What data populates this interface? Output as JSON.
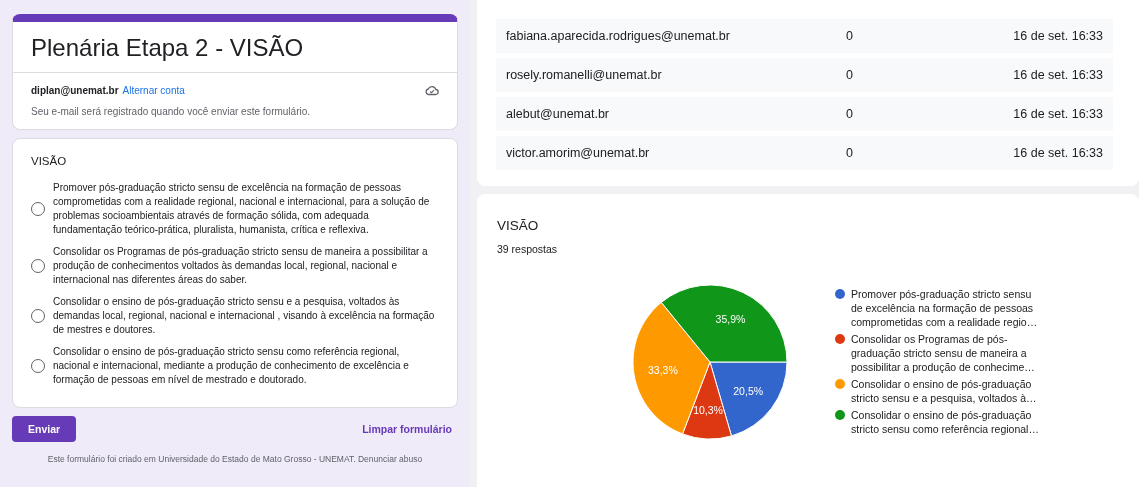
{
  "form": {
    "title": "Plenária Etapa 2 - VISÃO",
    "account": "diplan@unemat.br",
    "switch_account": "Alternar conta",
    "notice": "Seu e-mail será registrado quando você enviar este formulário.",
    "question": {
      "title": "VISÃO",
      "options": [
        {
          "label": "Promover pós-graduação stricto sensu de excelência na formação de pessoas comprometidas com a realidade regional, nacional e internacional, para a solução de problemas socioambientais através de formação sólida, com adequada fundamentação teórico-prática, pluralista, humanista, crítica e reflexiva.",
          "selected": false
        },
        {
          "label": "Consolidar os Programas de pós-graduação stricto sensu de maneira a possibilitar a produção de conhecimentos voltados às demandas local, regional, nacional e internacional nas diferentes áreas do saber.",
          "selected": false
        },
        {
          "label": "Consolidar o ensino de pós-graduação stricto sensu e a pesquisa, voltados às demandas local, regional, nacional e internacional , visando à excelência na formação de mestres e doutores.",
          "selected": false
        },
        {
          "label": "Consolidar o ensino de pós-graduação stricto sensu como referência regional, nacional e internacional, mediante a produção de conhecimento de excelência e formação de pessoas em nível de mestrado e doutorado.",
          "selected": false
        }
      ]
    },
    "submit": "Enviar",
    "clear": "Limpar formulário",
    "footer": "Este formulário foi criado em Universidade do Estado de Mato Grosso - UNEMAT. Denunciar abuso"
  },
  "responses_table": {
    "rows": [
      {
        "email": "fabiana.aparecida.rodrigues@unemat.br",
        "score": "0",
        "time": "16 de set. 16:33"
      },
      {
        "email": "rosely.romanelli@unemat.br",
        "score": "0",
        "time": "16 de set. 16:33"
      },
      {
        "email": "alebut@unemat.br",
        "score": "0",
        "time": "16 de set. 16:33"
      },
      {
        "email": "victor.amorim@unemat.br",
        "score": "0",
        "time": "16 de set. 16:33"
      }
    ]
  },
  "summary": {
    "title": "VISÃO",
    "count": "39 respostas",
    "chart_data": {
      "type": "pie",
      "categories": [
        "Promover pós-graduação stricto sensu de excelência na formação de pessoas comprometidas com a realidade regio…",
        "Consolidar os Programas de pós-graduação stricto sensu de maneira a possibilitar a produção de conhecime…",
        "Consolidar o ensino de pós-graduação stricto sensu e a pesquisa, voltados à…",
        "Consolidar o ensino de pós-graduação stricto sensu como referência regional…"
      ],
      "series": [
        {
          "values": [
            20.5,
            10.3,
            33.3,
            35.9
          ]
        }
      ],
      "colors": [
        "#3366cc",
        "#dc3912",
        "#ff9900",
        "#109618"
      ],
      "value_labels": [
        "20,5%",
        "10,3%",
        "33,3%",
        "35,9%"
      ]
    }
  }
}
